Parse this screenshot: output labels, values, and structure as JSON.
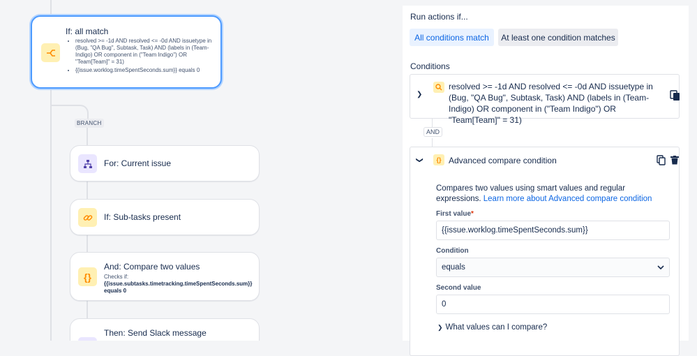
{
  "flow": {
    "if_card": {
      "title": "If: all match",
      "conditions": [
        "resolved >= -1d AND resolved <= -0d AND issuetype in (Bug, \"QA Bug\", Subtask, Task) AND (labels in (Team-Indigo) OR component in (\"Team Indigo\") OR \"Team[Team]\" = 31)",
        "{{issue.worklog.timeSpentSeconds.sum}} equals 0"
      ]
    },
    "branch_label": "BRANCH",
    "for_card": {
      "title": "For: Current issue"
    },
    "subtasks_card": {
      "title": "If: Sub-tasks present"
    },
    "compare_card": {
      "title": "And: Compare two values",
      "checks_label": "Checks if:",
      "checks_value": "{{issue.subtasks.timetracking.timeSpentSeconds.sum}} equals 0"
    },
    "slack_card": {
      "title": "Then: Send Slack message"
    }
  },
  "panel": {
    "run_actions_heading": "Run actions if...",
    "segmented": {
      "all": "All conditions match",
      "any": "At least one condition matches"
    },
    "conditions_heading": "Conditions",
    "jql_condition": "resolved >= -1d AND resolved <= -0d AND issuetype in (Bug, \"QA Bug\", Subtask, Task) AND (labels in (Team-Indigo) OR component in (\"Team Indigo\") OR \"Team[Team]\" = 31)",
    "and_label": "AND",
    "advanced": {
      "title": "Advanced compare condition",
      "description": "Compares two values using smart values and regular expressions.",
      "learn_more": "Learn more about Advanced compare condition",
      "first_value_label": "First value",
      "first_value": "{{issue.worklog.timeSpentSeconds.sum}}",
      "condition_label": "Condition",
      "condition_value": "equals",
      "second_value_label": "Second value",
      "second_value": "0",
      "what_values": "What values can I compare?"
    }
  },
  "colors": {
    "accent": "#0c66e4",
    "selected_border": "#4c9aff",
    "icon_orange": "#ff8b00",
    "icon_purple": "#5243aa"
  },
  "icons": [
    "branch-icon",
    "hierarchy-icon",
    "link-icon",
    "curly-braces-icon",
    "search-icon",
    "copy-icon",
    "trash-icon",
    "chevron-right-icon",
    "chevron-down-icon"
  ]
}
